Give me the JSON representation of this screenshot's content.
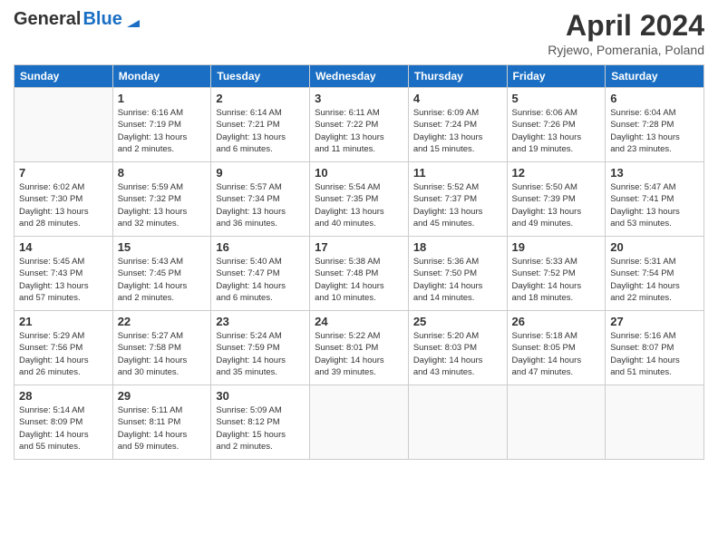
{
  "header": {
    "logo_general": "General",
    "logo_blue": "Blue",
    "month_year": "April 2024",
    "location": "Ryjewo, Pomerania, Poland"
  },
  "weekdays": [
    "Sunday",
    "Monday",
    "Tuesday",
    "Wednesday",
    "Thursday",
    "Friday",
    "Saturday"
  ],
  "weeks": [
    [
      {
        "day": "",
        "info": ""
      },
      {
        "day": "1",
        "info": "Sunrise: 6:16 AM\nSunset: 7:19 PM\nDaylight: 13 hours\nand 2 minutes."
      },
      {
        "day": "2",
        "info": "Sunrise: 6:14 AM\nSunset: 7:21 PM\nDaylight: 13 hours\nand 6 minutes."
      },
      {
        "day": "3",
        "info": "Sunrise: 6:11 AM\nSunset: 7:22 PM\nDaylight: 13 hours\nand 11 minutes."
      },
      {
        "day": "4",
        "info": "Sunrise: 6:09 AM\nSunset: 7:24 PM\nDaylight: 13 hours\nand 15 minutes."
      },
      {
        "day": "5",
        "info": "Sunrise: 6:06 AM\nSunset: 7:26 PM\nDaylight: 13 hours\nand 19 minutes."
      },
      {
        "day": "6",
        "info": "Sunrise: 6:04 AM\nSunset: 7:28 PM\nDaylight: 13 hours\nand 23 minutes."
      }
    ],
    [
      {
        "day": "7",
        "info": "Sunrise: 6:02 AM\nSunset: 7:30 PM\nDaylight: 13 hours\nand 28 minutes."
      },
      {
        "day": "8",
        "info": "Sunrise: 5:59 AM\nSunset: 7:32 PM\nDaylight: 13 hours\nand 32 minutes."
      },
      {
        "day": "9",
        "info": "Sunrise: 5:57 AM\nSunset: 7:34 PM\nDaylight: 13 hours\nand 36 minutes."
      },
      {
        "day": "10",
        "info": "Sunrise: 5:54 AM\nSunset: 7:35 PM\nDaylight: 13 hours\nand 40 minutes."
      },
      {
        "day": "11",
        "info": "Sunrise: 5:52 AM\nSunset: 7:37 PM\nDaylight: 13 hours\nand 45 minutes."
      },
      {
        "day": "12",
        "info": "Sunrise: 5:50 AM\nSunset: 7:39 PM\nDaylight: 13 hours\nand 49 minutes."
      },
      {
        "day": "13",
        "info": "Sunrise: 5:47 AM\nSunset: 7:41 PM\nDaylight: 13 hours\nand 53 minutes."
      }
    ],
    [
      {
        "day": "14",
        "info": "Sunrise: 5:45 AM\nSunset: 7:43 PM\nDaylight: 13 hours\nand 57 minutes."
      },
      {
        "day": "15",
        "info": "Sunrise: 5:43 AM\nSunset: 7:45 PM\nDaylight: 14 hours\nand 2 minutes."
      },
      {
        "day": "16",
        "info": "Sunrise: 5:40 AM\nSunset: 7:47 PM\nDaylight: 14 hours\nand 6 minutes."
      },
      {
        "day": "17",
        "info": "Sunrise: 5:38 AM\nSunset: 7:48 PM\nDaylight: 14 hours\nand 10 minutes."
      },
      {
        "day": "18",
        "info": "Sunrise: 5:36 AM\nSunset: 7:50 PM\nDaylight: 14 hours\nand 14 minutes."
      },
      {
        "day": "19",
        "info": "Sunrise: 5:33 AM\nSunset: 7:52 PM\nDaylight: 14 hours\nand 18 minutes."
      },
      {
        "day": "20",
        "info": "Sunrise: 5:31 AM\nSunset: 7:54 PM\nDaylight: 14 hours\nand 22 minutes."
      }
    ],
    [
      {
        "day": "21",
        "info": "Sunrise: 5:29 AM\nSunset: 7:56 PM\nDaylight: 14 hours\nand 26 minutes."
      },
      {
        "day": "22",
        "info": "Sunrise: 5:27 AM\nSunset: 7:58 PM\nDaylight: 14 hours\nand 30 minutes."
      },
      {
        "day": "23",
        "info": "Sunrise: 5:24 AM\nSunset: 7:59 PM\nDaylight: 14 hours\nand 35 minutes."
      },
      {
        "day": "24",
        "info": "Sunrise: 5:22 AM\nSunset: 8:01 PM\nDaylight: 14 hours\nand 39 minutes."
      },
      {
        "day": "25",
        "info": "Sunrise: 5:20 AM\nSunset: 8:03 PM\nDaylight: 14 hours\nand 43 minutes."
      },
      {
        "day": "26",
        "info": "Sunrise: 5:18 AM\nSunset: 8:05 PM\nDaylight: 14 hours\nand 47 minutes."
      },
      {
        "day": "27",
        "info": "Sunrise: 5:16 AM\nSunset: 8:07 PM\nDaylight: 14 hours\nand 51 minutes."
      }
    ],
    [
      {
        "day": "28",
        "info": "Sunrise: 5:14 AM\nSunset: 8:09 PM\nDaylight: 14 hours\nand 55 minutes."
      },
      {
        "day": "29",
        "info": "Sunrise: 5:11 AM\nSunset: 8:11 PM\nDaylight: 14 hours\nand 59 minutes."
      },
      {
        "day": "30",
        "info": "Sunrise: 5:09 AM\nSunset: 8:12 PM\nDaylight: 15 hours\nand 2 minutes."
      },
      {
        "day": "",
        "info": ""
      },
      {
        "day": "",
        "info": ""
      },
      {
        "day": "",
        "info": ""
      },
      {
        "day": "",
        "info": ""
      }
    ]
  ]
}
